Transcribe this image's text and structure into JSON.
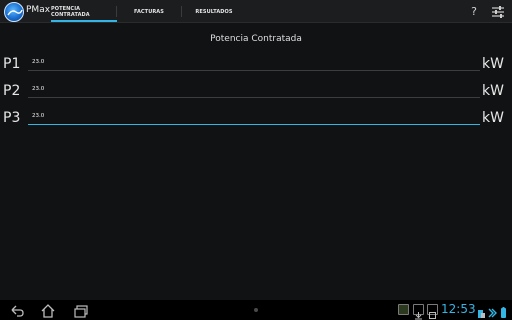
{
  "app": {
    "title": "PMax"
  },
  "tabs": [
    {
      "label": "POTENCIA CONTRATADA",
      "selected": true
    },
    {
      "label": "FACTURAS",
      "selected": false
    },
    {
      "label": "RESULTADOS",
      "selected": false
    }
  ],
  "actions": {
    "help_label": "?",
    "help_icon": "help-icon",
    "settings_icon": "settings-sliders-icon"
  },
  "main": {
    "section_title": "Potencia Contratada",
    "rows": [
      {
        "label": "P1",
        "value": "23.0",
        "unit": "kW"
      },
      {
        "label": "P2",
        "value": "23.0",
        "unit": "kW"
      },
      {
        "label": "P3",
        "value": "23.0",
        "unit": "kW"
      }
    ]
  },
  "system_bar": {
    "clock": "12:53",
    "nav_icons": [
      "back-icon",
      "home-icon",
      "recent-apps-icon"
    ]
  },
  "colors": {
    "accent": "#33b5e5",
    "background": "#111213",
    "actionbar": "#1c1d1f"
  }
}
